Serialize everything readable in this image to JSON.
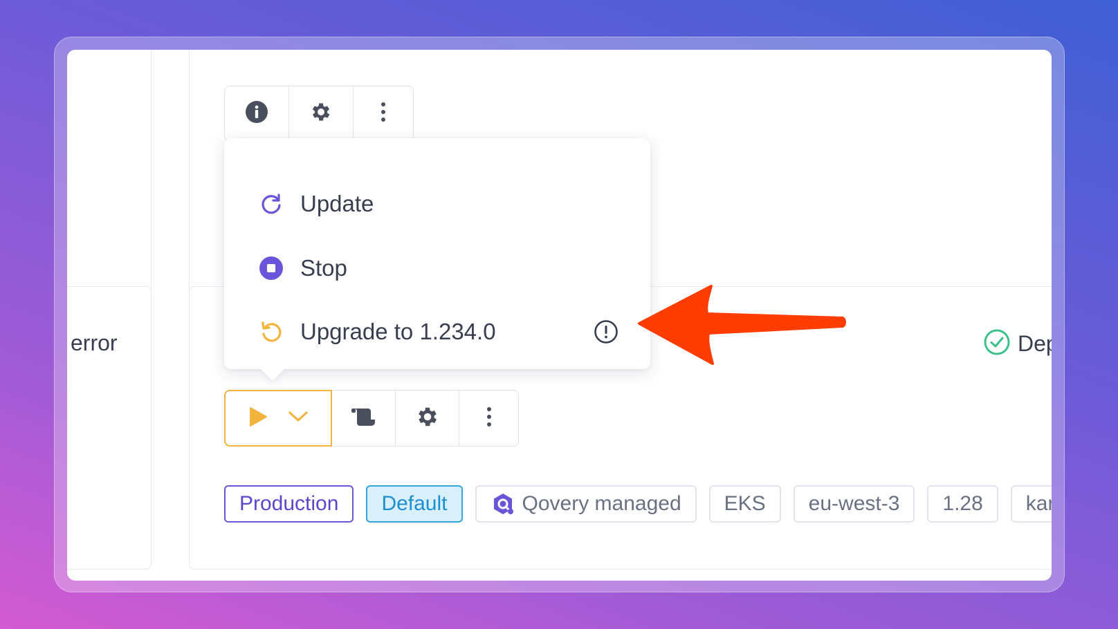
{
  "menu": {
    "update": "Update",
    "stop": "Stop",
    "upgrade": "Upgrade to 1.234.0"
  },
  "left_status": "error",
  "right_status": "Dep",
  "tags": [
    {
      "label": "Production"
    },
    {
      "label": "Default"
    },
    {
      "label": "Qovery managed"
    },
    {
      "label": "EKS"
    },
    {
      "label": "eu-west-3"
    },
    {
      "label": "1.28"
    },
    {
      "label": "karpe"
    }
  ],
  "icons": {
    "top_toolbar": [
      "info-icon",
      "gear-icon",
      "more-vertical-icon"
    ],
    "bottom_toolbar": [
      "play-icon",
      "chevron-down-icon",
      "logs-icon",
      "gear-icon",
      "more-vertical-icon"
    ],
    "update": "refresh-icon",
    "stop": "stop-icon",
    "upgrade": "undo-icon",
    "upgrade_hint": "warning-circle-icon",
    "status": "check-circle-icon",
    "qovery": "qovery-logo-icon",
    "annotation": "red-arrow-icon"
  },
  "colors": {
    "accent_purple": "#6a55d8",
    "accent_yellow": "#f3b43d",
    "default_blue": "#31a6e0",
    "success_green": "#3cc08a",
    "annotation_red": "#ff3d00"
  }
}
